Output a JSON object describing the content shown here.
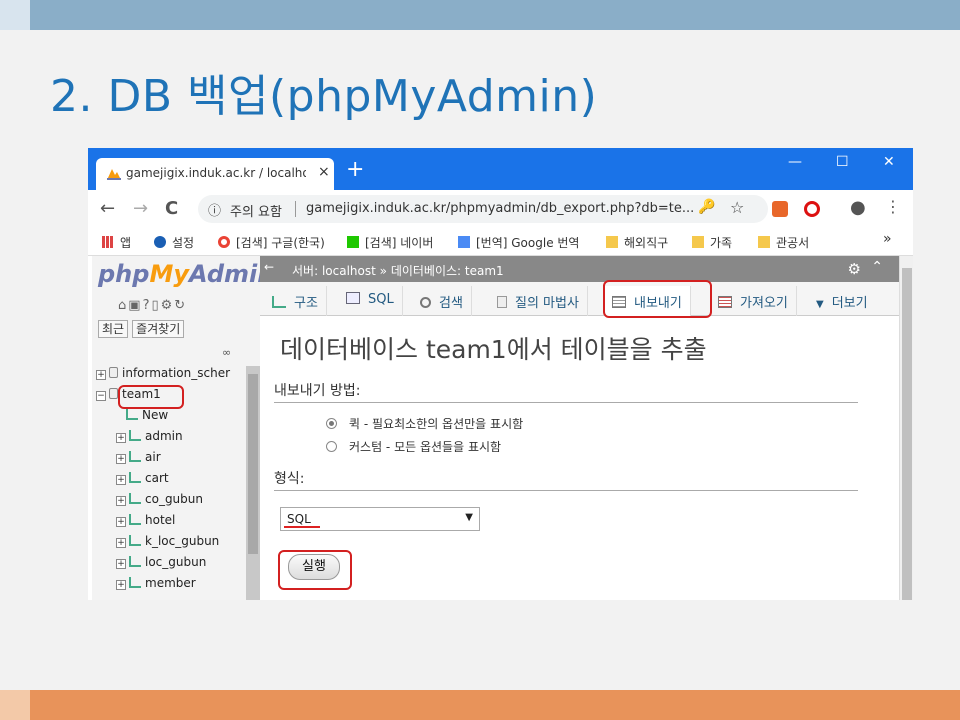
{
  "slide": {
    "title": "2. DB 백업(phpMyAdmin)"
  },
  "browser": {
    "tab_title": "gamejigix.induk.ac.kr / localhost",
    "tab_close": "×",
    "new_tab": "+",
    "window_controls": {
      "minimize": "—",
      "maximize": "☐",
      "close": "✕"
    },
    "nav": {
      "back": "←",
      "forward": "→",
      "reload": "C"
    },
    "omnibox": {
      "info_icon": "ⓘ",
      "security_label": "주의 요함",
      "url": "gamejigix.induk.ac.kr/phpmyadmin/db_export.php?db=te...",
      "key_icon": "🔑",
      "star_icon": "☆"
    },
    "bookmarks": [
      {
        "label": "앱",
        "icon": "apps-icon"
      },
      {
        "label": "설정",
        "icon": "gear-icon"
      },
      {
        "label": "[검색] 구글(한국)",
        "icon": "google-icon"
      },
      {
        "label": "[검색] 네이버",
        "icon": "naver-icon"
      },
      {
        "label": "[번역] Google 번역",
        "icon": "translate-icon"
      },
      {
        "label": "해외직구",
        "icon": "folder-icon"
      },
      {
        "label": "가족",
        "icon": "folder-icon"
      },
      {
        "label": "관공서",
        "icon": "folder-icon"
      }
    ],
    "bookmarks_more": "»",
    "colors": {
      "tabstrip": "#1a73e8",
      "highlight": "#d32020"
    }
  },
  "pma": {
    "logo_php": "php",
    "logo_my": "My",
    "logo_admin": "Admin",
    "nav_links": [
      "최근",
      "즐겨찾기"
    ],
    "tree": [
      {
        "label": "information_scher",
        "level": 0,
        "type": "db",
        "expander": "+"
      },
      {
        "label": "team1",
        "level": 0,
        "type": "db",
        "expander": "−"
      },
      {
        "label": "New",
        "level": 1,
        "type": "new",
        "expander": ""
      },
      {
        "label": "admin",
        "level": 1,
        "type": "table",
        "expander": "+"
      },
      {
        "label": "air",
        "level": 1,
        "type": "table",
        "expander": "+"
      },
      {
        "label": "cart",
        "level": 1,
        "type": "table",
        "expander": "+"
      },
      {
        "label": "co_gubun",
        "level": 1,
        "type": "table",
        "expander": "+"
      },
      {
        "label": "hotel",
        "level": 1,
        "type": "table",
        "expander": "+"
      },
      {
        "label": "k_loc_gubun",
        "level": 1,
        "type": "table",
        "expander": "+"
      },
      {
        "label": "loc_gubun",
        "level": 1,
        "type": "table",
        "expander": "+"
      },
      {
        "label": "member",
        "level": 1,
        "type": "table",
        "expander": "+"
      }
    ],
    "breadcrumb": {
      "back": "←",
      "server": "서버: localhost",
      "separator": "»",
      "database": "데이터베이스: team1",
      "gear": "⚙",
      "collapse": "⌃"
    },
    "tabs": [
      {
        "label": "구조",
        "icon": "structure-icon"
      },
      {
        "label": "SQL",
        "icon": "sql-icon"
      },
      {
        "label": "검색",
        "icon": "search-icon"
      },
      {
        "label": "질의 마법사",
        "icon": "query-icon"
      },
      {
        "label": "내보내기",
        "icon": "export-icon",
        "active": true
      },
      {
        "label": "가져오기",
        "icon": "import-icon"
      },
      {
        "label": "더보기",
        "icon": "chevron-down-icon"
      }
    ],
    "heading": "데이터베이스 team1에서 테이블을 추출",
    "export_method_label": "내보내기 방법:",
    "export_methods": [
      {
        "label": "퀵 - 필요최소한의 옵션만을 표시함",
        "checked": true
      },
      {
        "label": "커스텀 - 모든 옵션들을 표시함",
        "checked": false
      }
    ],
    "format_label": "형식:",
    "format_value": "SQL",
    "go_label": "실행"
  }
}
